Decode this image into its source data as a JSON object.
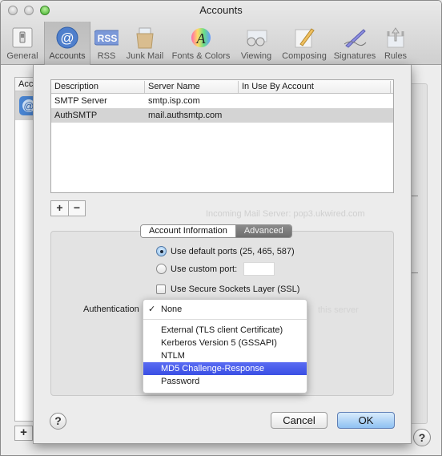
{
  "window": {
    "title": "Accounts"
  },
  "toolbar": {
    "items": [
      {
        "label": "General",
        "icon": "general-switch-icon",
        "active": false
      },
      {
        "label": "Accounts",
        "icon": "at-sign-icon",
        "active": true
      },
      {
        "label": "RSS",
        "icon": "rss-icon",
        "active": false
      },
      {
        "label": "Junk Mail",
        "icon": "junk-mail-icon",
        "active": false
      },
      {
        "label": "Fonts & Colors",
        "icon": "fonts-colors-icon",
        "active": false
      },
      {
        "label": "Viewing",
        "icon": "viewing-glasses-icon",
        "active": false
      },
      {
        "label": "Composing",
        "icon": "composing-pencil-icon",
        "active": false
      },
      {
        "label": "Signatures",
        "icon": "signatures-pen-icon",
        "active": false
      },
      {
        "label": "Rules",
        "icon": "rules-arrows-icon",
        "active": false
      }
    ]
  },
  "background": {
    "accounts_list_header": "Acc",
    "add_label": "+",
    "help_label": "?",
    "ghost_text_1": "Incoming Mail Server: pop3.ukwired.com",
    "ghost_text_2": "this server"
  },
  "sheet": {
    "table": {
      "columns": [
        "Description",
        "Server Name",
        "In Use By Account"
      ],
      "rows": [
        {
          "description": "SMTP Server",
          "server": "smtp.isp.com",
          "account": "",
          "selected": false
        },
        {
          "description": "AuthSMTP",
          "server": "mail.authsmtp.com",
          "account": "",
          "selected": true
        }
      ]
    },
    "add_label": "+",
    "remove_label": "−",
    "tabs": [
      {
        "label": "Account Information",
        "selected": false
      },
      {
        "label": "Advanced",
        "selected": true
      }
    ],
    "ports": {
      "default_label": "Use default ports (25, 465, 587)",
      "custom_label": "Use custom port:",
      "selected": "default",
      "custom_value": ""
    },
    "ssl": {
      "label": "Use Secure Sockets Layer (SSL)",
      "checked": false
    },
    "authentication": {
      "label": "Authentication",
      "selected": "None",
      "check_glyph": "✓",
      "options_top": [
        "None"
      ],
      "options": [
        "External (TLS client Certificate)",
        "Kerberos Version 5 (GSSAPI)",
        "NTLM",
        "MD5 Challenge-Response",
        "Password"
      ],
      "highlighted": "MD5 Challenge-Response"
    },
    "help_label": "?",
    "cancel_label": "Cancel",
    "ok_label": "OK"
  }
}
